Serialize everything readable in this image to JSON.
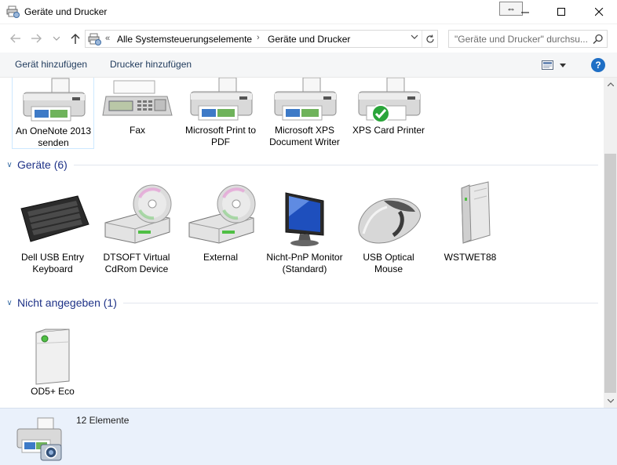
{
  "window": {
    "title": "Geräte und Drucker",
    "resize_glyph": "⇔"
  },
  "address_bar": {
    "overflow": "«",
    "crumbs": [
      "Alle Systemsteuerungselemente",
      "Geräte und Drucker"
    ],
    "separator": "›",
    "search_placeholder": "\"Geräte und Drucker\" durchsu..."
  },
  "toolbar": {
    "add_device": "Gerät hinzufügen",
    "add_printer": "Drucker hinzufügen",
    "help": "?"
  },
  "printers": [
    {
      "label": "An OneNote 2013 senden",
      "icon": "printer-icon"
    },
    {
      "label": "Fax",
      "icon": "fax-icon"
    },
    {
      "label": "Microsoft Print to PDF",
      "icon": "printer-icon"
    },
    {
      "label": "Microsoft XPS Document Writer",
      "icon": "printer-icon"
    },
    {
      "label": "XPS Card Printer",
      "icon": "printer-default-icon"
    }
  ],
  "groups": {
    "devices": {
      "title": "Geräte (6)",
      "chevron": "∨"
    },
    "unspecified": {
      "title": "Nicht angegeben (1)",
      "chevron": "∨"
    }
  },
  "devices": [
    {
      "label": "Dell USB Entry Keyboard",
      "icon": "keyboard-icon"
    },
    {
      "label": "DTSOFT Virtual CdRom Device",
      "icon": "cd-drive-icon"
    },
    {
      "label": "External",
      "icon": "cd-drive-icon"
    },
    {
      "label": "Nicht-PnP Monitor (Standard)",
      "icon": "monitor-icon"
    },
    {
      "label": "USB Optical Mouse",
      "icon": "mouse-icon"
    },
    {
      "label": "WSTWET88",
      "icon": "server-icon"
    }
  ],
  "unspecified": [
    {
      "label": "OD5+ Eco",
      "icon": "nas-icon"
    }
  ],
  "details": {
    "count": "12 Elemente"
  },
  "colors": {
    "accent_blue": "#1e3287",
    "toolbar_text": "#1e395b",
    "details_bg": "#eaf1fb",
    "check_green": "#2aa53a"
  }
}
